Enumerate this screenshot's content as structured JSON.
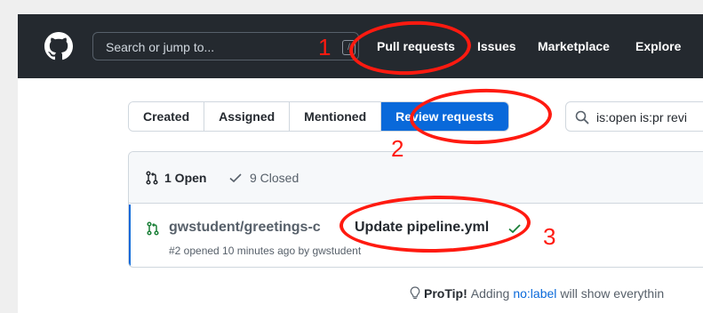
{
  "header": {
    "search_placeholder": "Search or jump to...",
    "search_shortcut": "/",
    "nav": [
      "Pull requests",
      "Issues",
      "Marketplace",
      "Explore"
    ]
  },
  "filter_tabs": {
    "items": [
      "Created",
      "Assigned",
      "Mentioned",
      "Review requests"
    ],
    "selected": "Review requests"
  },
  "filter_query": "is:open is:pr revi",
  "list": {
    "open_count_label": "1 Open",
    "closed_count_label": "9 Closed",
    "pr": {
      "repo": "gwstudent/greetings-c",
      "title": "Update pipeline.yml",
      "meta": "#2 opened 10 minutes ago by gwstudent"
    }
  },
  "protip": {
    "label": "ProTip!",
    "text_before": "Adding",
    "link": "no:label",
    "text_after": "will show everythin"
  },
  "annotations": [
    "1",
    "2",
    "3"
  ],
  "colors": {
    "header_bg": "#24292f",
    "selected_tab": "#0969da",
    "annotation": "#ff1a10",
    "check": "#1a7f37"
  }
}
